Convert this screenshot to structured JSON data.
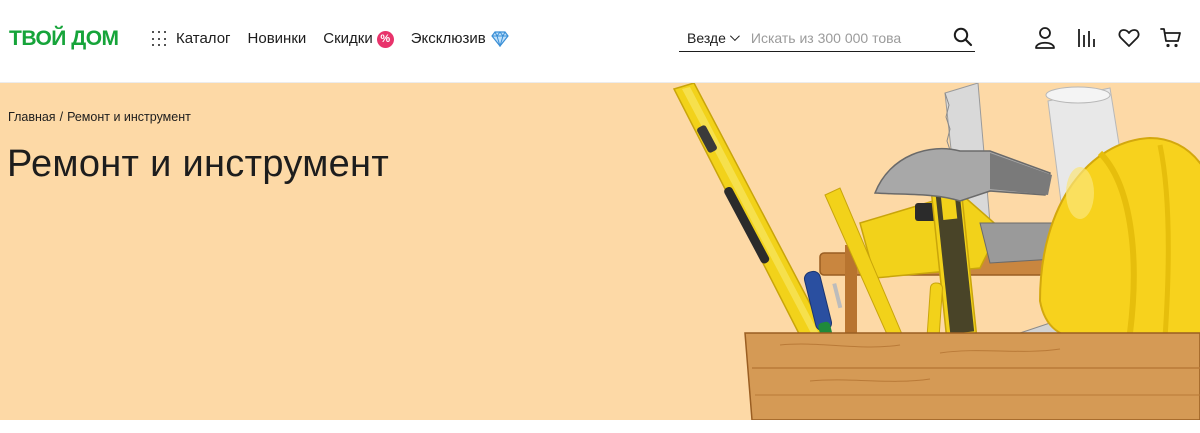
{
  "header": {
    "logo": "ТВОЙ ДОМ",
    "nav": {
      "catalog": "Каталог",
      "new": "Новинки",
      "discounts": "Скидки",
      "discount_badge": "%",
      "exclusive": "Эксклюзив"
    },
    "search": {
      "scope": "Везде",
      "placeholder": "Искать из 300 000 това"
    },
    "icons": [
      "user-icon",
      "compare-icon",
      "heart-icon",
      "cart-icon"
    ]
  },
  "banner": {
    "breadcrumb": {
      "home": "Главная",
      "separator": "/",
      "current": "Ремонт и инструмент"
    },
    "title": "Ремонт и инструмент",
    "image": "tools-toolbox-illustration"
  },
  "colors": {
    "brand": "#16a43a",
    "banner_bg": "#fdd9a6",
    "discount_badge": "#e8336b",
    "diamond": "#3a8fd6"
  }
}
